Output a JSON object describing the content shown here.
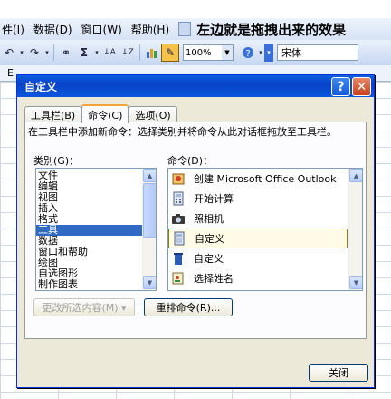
{
  "menubar": {
    "items": [
      "文件",
      "数据(D)",
      "窗口(W)",
      "帮助(H)"
    ],
    "visible_items": [
      "件(I)",
      "数据(D)",
      "窗口(W)",
      "帮助(H)"
    ],
    "annotation": "左边就是拖拽出来的效果"
  },
  "toolbar": {
    "zoom": "100%",
    "font": "宋体",
    "sigma": "Σ",
    "sort_asc": "↓A",
    "sort_desc": "↓Z"
  },
  "sheet": {
    "column_label": "E"
  },
  "dialog": {
    "title": "自定义",
    "help_label": "?",
    "close_label": "✕",
    "tabs": [
      "工具栏(B)",
      "命令(C)",
      "选项(O)"
    ],
    "instruction": "在工具栏中添加新命令：选择类别并将命令从此对话框拖放至工具栏。",
    "categories_label": "类别(G)：",
    "commands_label": "命令(D)：",
    "categories": [
      "文件",
      "编辑",
      "视图",
      "插入",
      "格式",
      "工具",
      "数据",
      "窗口和帮助",
      "绘图",
      "自选图形",
      "制作图表"
    ],
    "selected_category": "工具",
    "commands": [
      {
        "label": "创建 Microsoft Office Outlook",
        "icon": "outlook-icon"
      },
      {
        "label": "开始计算",
        "icon": "calculator-icon"
      },
      {
        "label": "照相机",
        "icon": "camera-icon"
      },
      {
        "label": "自定义",
        "icon": "customize-icon"
      },
      {
        "label": "自定义",
        "icon": "trash-icon"
      },
      {
        "label": "选择姓名",
        "icon": "address-book-icon"
      }
    ],
    "selected_command": "自定义",
    "modify_selection_label": "更改所选内容(M) ▾",
    "rearrange_label": "重排命令(R)...",
    "close_button_label": "关闭"
  }
}
